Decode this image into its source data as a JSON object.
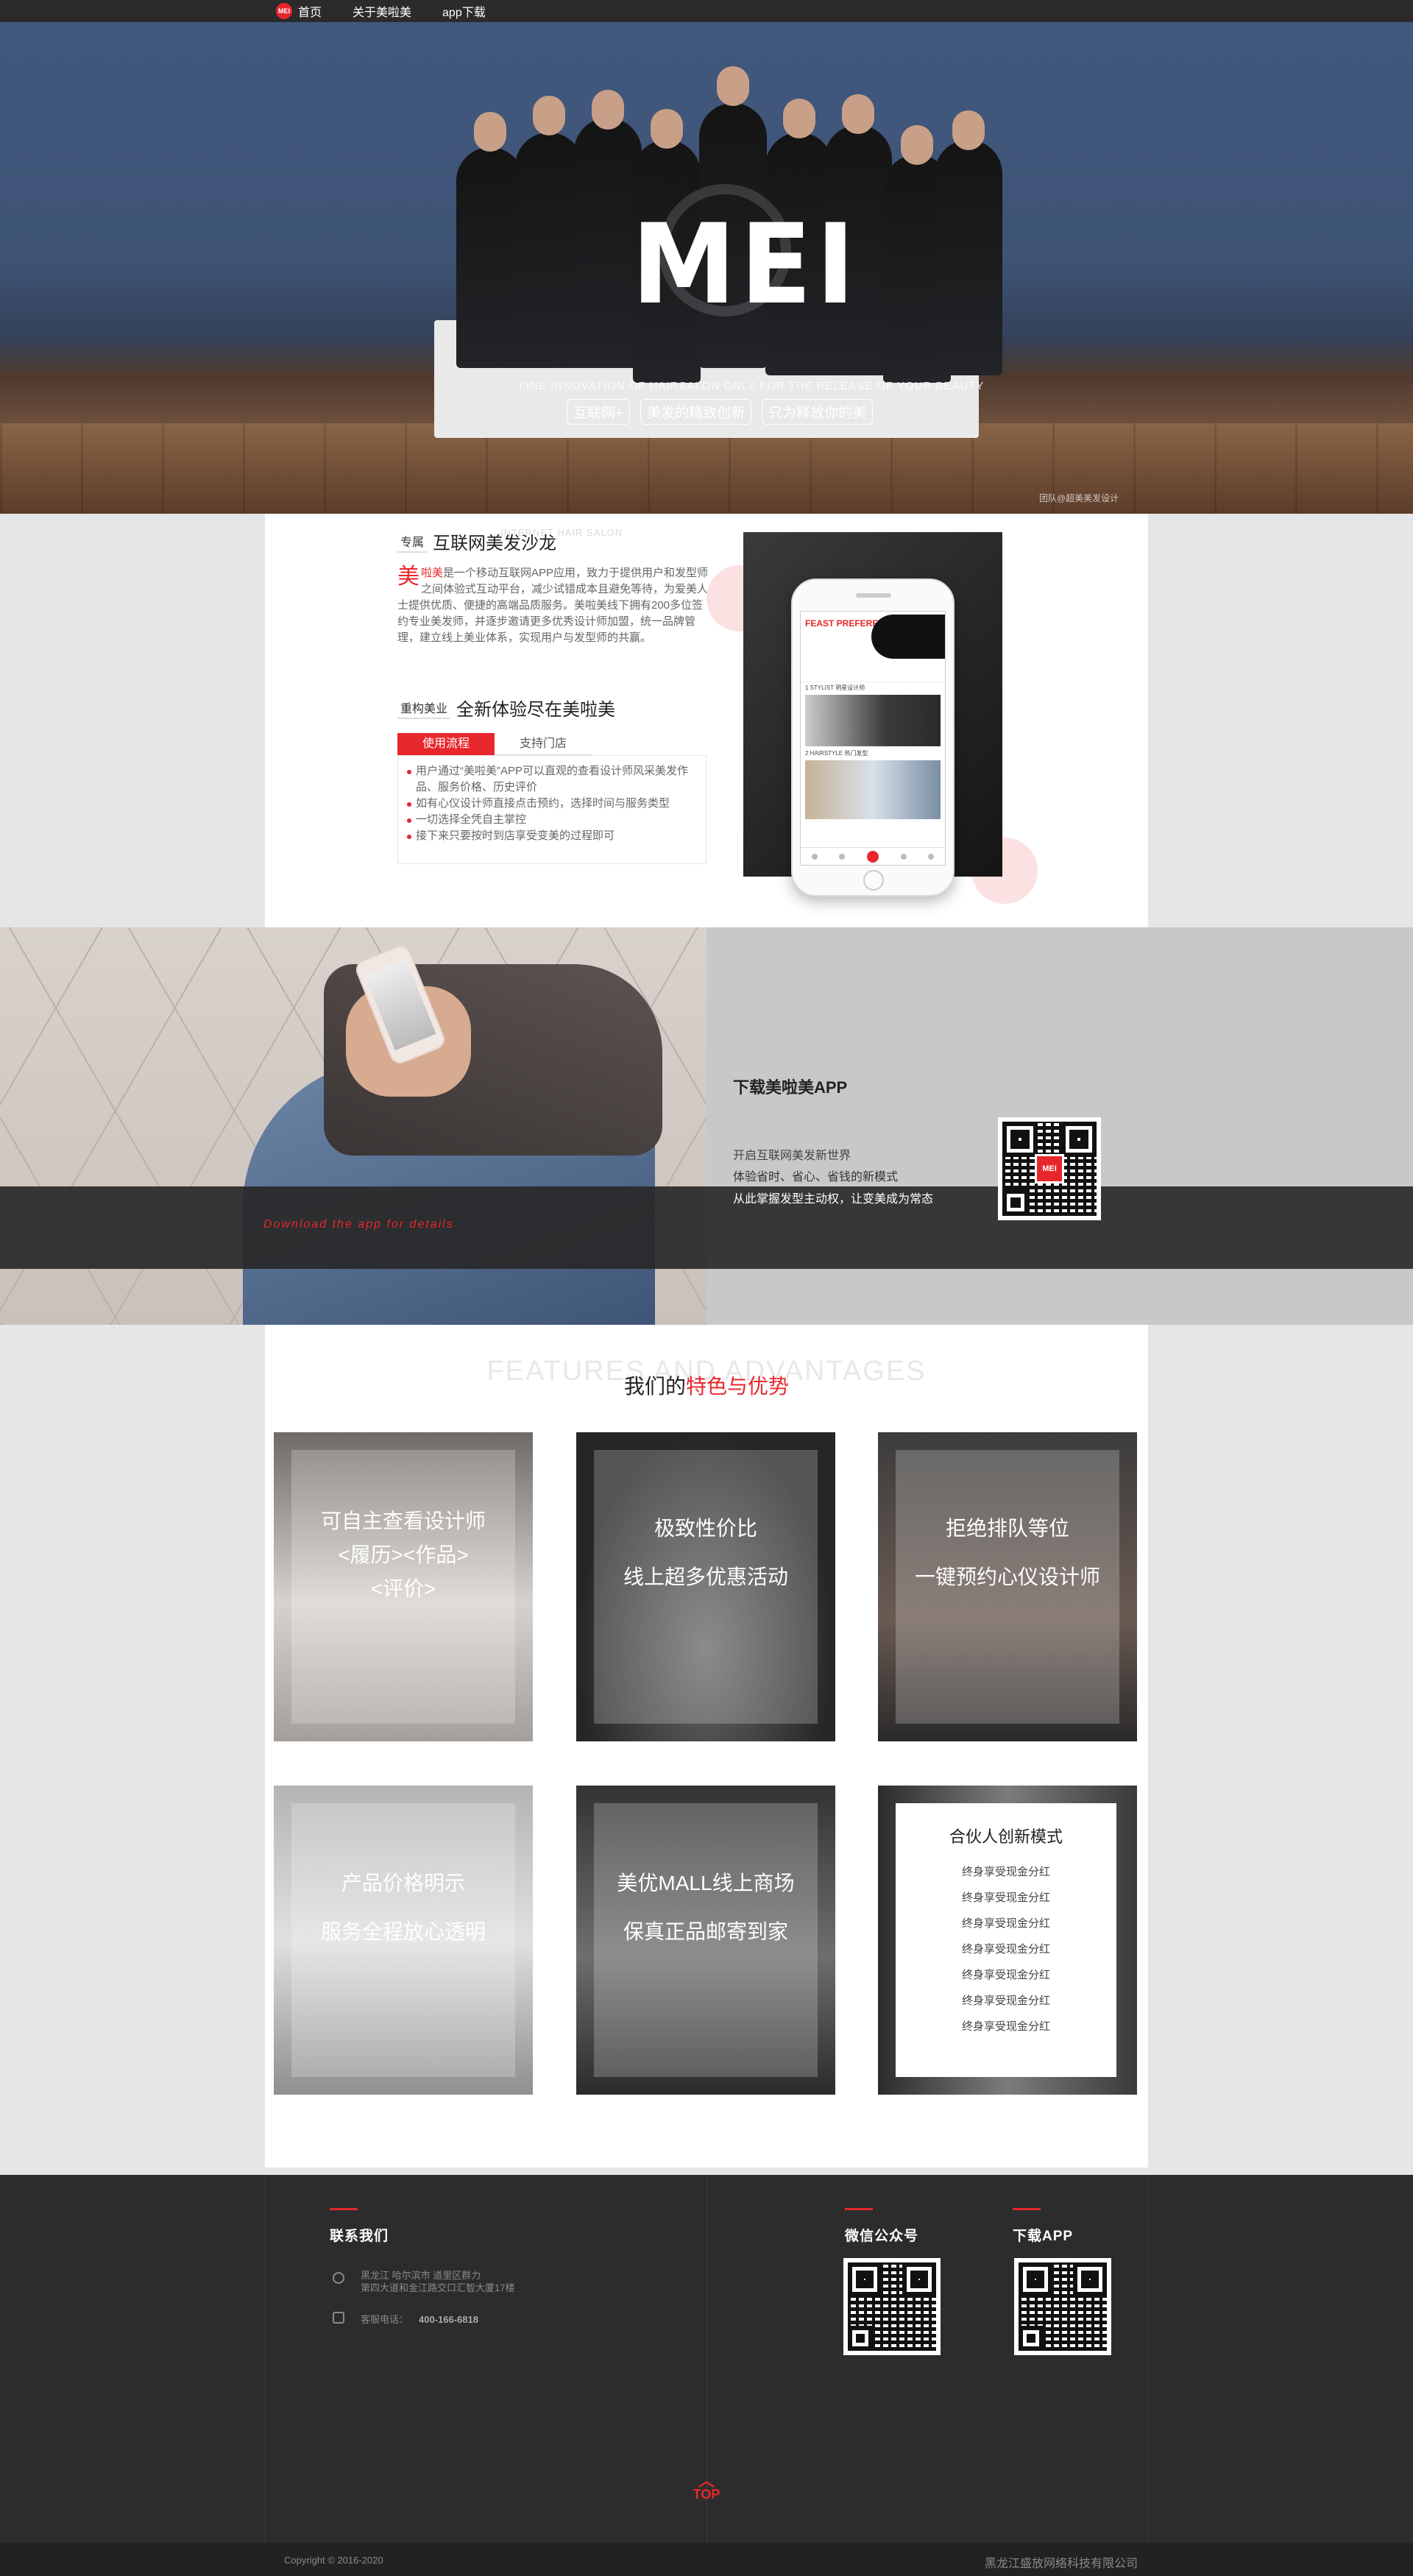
{
  "nav": {
    "logo": "MEI",
    "items": [
      "首页",
      "关于美啦美",
      "app下载"
    ]
  },
  "hero": {
    "mark": "MEI",
    "subtitle": "FINE INNOVATION OF HAIRSALON ONLY FOR THE RELEASE OF YOUR BEAUTY",
    "tags": [
      "互联网+",
      "美发的精致创新",
      "只为释放你的美"
    ],
    "credit": "团队@超美美发设计"
  },
  "intro": {
    "section1_tag": "专属",
    "section1_title": "互联网美发沙龙",
    "ghost1": "INTERNET HAIR SALON",
    "lead_big": "美",
    "lead_brand": "啦美",
    "paragraph": "是一个移动互联网APP应用，致力于提供用户和发型师之间体验式互动平台，减少试错成本且避免等待，为爱美人士提供优质、便捷的高端品质服务。美啦美线下拥有200多位签约专业美发师，并逐步邀请更多优秀设计师加盟，统一品牌管理，建立线上美业体系，实现用户与发型师的共赢。",
    "section2_tag": "重构美业",
    "section2_title": "全新体验尽在美啦美",
    "tabs": [
      "使用流程",
      "支持门店"
    ],
    "steps": [
      "用户通过“美啦美”APP可以直观的查看设计师风采美发作品、服务价格、历史评价",
      "如有心仪设计师直接点击预约，选择时间与服务类型",
      "一切选择全凭自主掌控",
      "接下来只要按时到店享受变美的过程即可"
    ],
    "screen": {
      "banner": "FEAST PREFERENTIAL",
      "line1": "1 STYLIST 明星设计师",
      "line2": "2 HAIRSTYLE 热门发型"
    }
  },
  "download": {
    "script": "Download the app for details",
    "title": "下载美啦美APP",
    "line1": "开启互联网美发新世界",
    "line2": "体验省时、省心、省钱的新模式",
    "line3": "从此掌握发型主动权，让变美成为常态",
    "qr_logo": "MEI"
  },
  "features": {
    "ghost": "FEATURES AND ADVANTAGES",
    "title_pre": "我们的",
    "title_red": "特色与优势",
    "cards": [
      {
        "lines": [
          "可自主查看设计师",
          "<履历><作品>",
          "<评价>"
        ]
      },
      {
        "lines": [
          "极致性价比",
          "线上超多优惠活动"
        ]
      },
      {
        "lines": [
          "拒绝排队等位",
          "一键预约心仪设计师"
        ]
      },
      {
        "lines": [
          "产品价格明示",
          "服务全程放心透明"
        ]
      },
      {
        "lines": [
          "美优MALL线上商场",
          "保真正品邮寄到家"
        ]
      }
    ],
    "partner": {
      "title": "合伙人创新模式",
      "items": [
        "终身享受现金分红",
        "终身享受现金分红",
        "终身享受现金分红",
        "终身享受现金分红",
        "终身享受现金分红",
        "终身享受现金分红",
        "终身享受现金分红"
      ]
    }
  },
  "footer": {
    "contact_title": "联系我们",
    "address_line1": "黑龙江    哈尔滨市    道里区群力",
    "address_line2": "第四大道和金江路交口汇智大厦17楼",
    "tel_label": "客服电话：",
    "tel": "400-166-6818",
    "wechat_title": "微信公众号",
    "app_title": "下载APP",
    "top_label": "TOP",
    "copyright": "Copyright © 2016-2020",
    "company": "黑龙江盛放网络科技有限公司"
  }
}
